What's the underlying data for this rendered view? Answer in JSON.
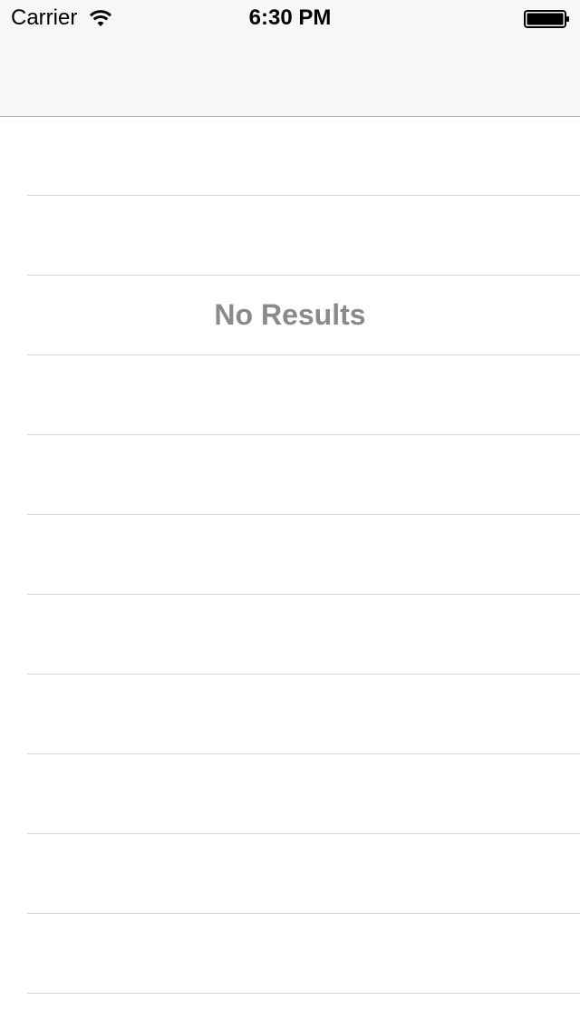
{
  "status_bar": {
    "carrier": "Carrier",
    "time": "6:30 PM",
    "wifi_icon": "wifi-icon",
    "battery_icon": "battery-full-icon"
  },
  "table": {
    "empty_message": "No Results",
    "separator_color": "#d9d9d9",
    "empty_text_color": "#8a8a8a"
  }
}
